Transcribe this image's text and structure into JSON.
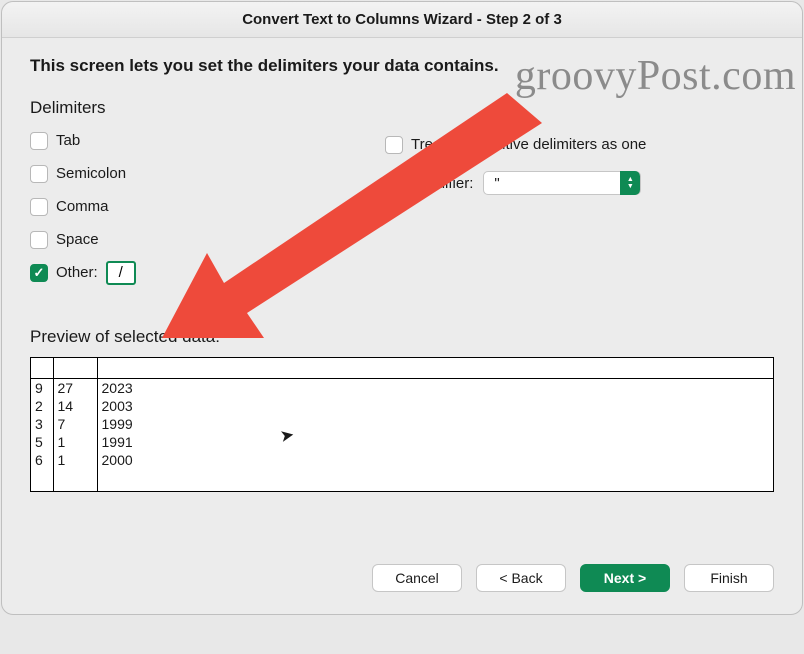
{
  "window": {
    "title": "Convert Text to Columns Wizard - Step 2 of 3"
  },
  "watermark": "groovyPost.com",
  "instruction": "This screen lets you set the delimiters your data contains.",
  "delimiters": {
    "heading": "Delimiters",
    "tab": {
      "label": "Tab",
      "checked": false
    },
    "semicolon": {
      "label": "Semicolon",
      "checked": false
    },
    "comma": {
      "label": "Comma",
      "checked": false
    },
    "space": {
      "label": "Space",
      "checked": false
    },
    "other": {
      "label": "Other:",
      "checked": true,
      "value": "/"
    }
  },
  "options": {
    "treat_consecutive": {
      "label": "Treat consecutive delimiters as one",
      "checked": false
    },
    "text_qualifier_label": "Text qualifier:",
    "text_qualifier_value": "\""
  },
  "preview": {
    "label": "Preview of selected data:",
    "rows": [
      {
        "c1": "9",
        "c2": "27",
        "c3": "2023"
      },
      {
        "c1": "2",
        "c2": "14",
        "c3": "2003"
      },
      {
        "c1": "3",
        "c2": "7",
        "c3": "1999"
      },
      {
        "c1": "5",
        "c2": "1",
        "c3": "1991"
      },
      {
        "c1": "6",
        "c2": "1",
        "c3": "2000"
      }
    ]
  },
  "buttons": {
    "cancel": "Cancel",
    "back": "< Back",
    "next": "Next >",
    "finish": "Finish"
  }
}
